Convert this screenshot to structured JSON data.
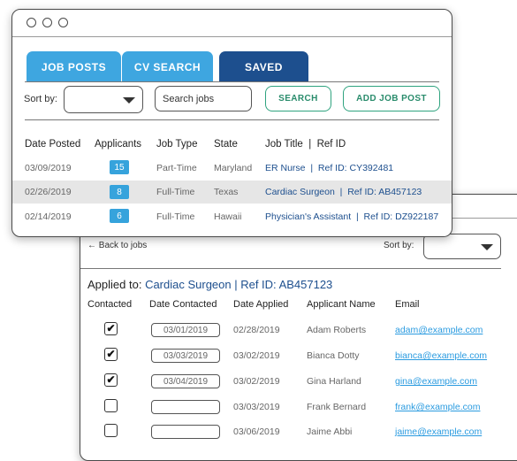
{
  "jobs_window": {
    "tabs": [
      {
        "label": "JOB POSTS"
      },
      {
        "label": "CV SEARCH"
      },
      {
        "label": "SAVED"
      }
    ],
    "sort_label": "Sort by:",
    "search_text": "Search jobs",
    "search_button": "SEARCH",
    "add_button": "ADD JOB POST",
    "columns": [
      "Date Posted",
      "Applicants",
      "Job Type",
      "State",
      "Job Title  |  Ref ID"
    ],
    "rows": [
      {
        "date": "03/09/2019",
        "applicants": "15",
        "type": "Part-Time",
        "state": "Maryland",
        "title": "ER Nurse  |  Ref ID: CY392481"
      },
      {
        "date": "02/26/2019",
        "applicants": "8",
        "type": "Full-Time",
        "state": "Texas",
        "title": "Cardiac Surgeon  |  Ref ID: AB457123"
      },
      {
        "date": "02/14/2019",
        "applicants": "6",
        "type": "Full-Time",
        "state": "Hawaii",
        "title": "Physician's Assistant  |  Ref ID: DZ922187"
      }
    ]
  },
  "applicants_window": {
    "back_link": "← Back to jobs",
    "sort_label": "Sort by:",
    "applied_prefix": "Applied to:",
    "applied_job": "Cardiac Surgeon  |  Ref ID: AB457123",
    "columns": [
      "Contacted",
      "Date Contacted",
      "Date Applied",
      "Applicant Name",
      "Email"
    ],
    "rows": [
      {
        "contacted": "✔",
        "date_contacted": "03/01/2019",
        "date_applied": "02/28/2019",
        "name": "Adam Roberts",
        "email": "adam@example.com"
      },
      {
        "contacted": "✔",
        "date_contacted": "03/03/2019",
        "date_applied": "03/02/2019",
        "name": "Bianca Dotty",
        "email": "bianca@example.com"
      },
      {
        "contacted": "✔",
        "date_contacted": "03/04/2019",
        "date_applied": "03/02/2019",
        "name": "Gina Harland",
        "email": "gina@example.com"
      },
      {
        "contacted": "",
        "date_contacted": "",
        "date_applied": "03/03/2019",
        "name": "Frank Bernard",
        "email": "frank@example.com"
      },
      {
        "contacted": "",
        "date_contacted": "",
        "date_applied": "03/06/2019",
        "name": "Jaime Abbi",
        "email": "jaime@example.com"
      }
    ]
  },
  "colors": {
    "tab_light": "#3ea6e0",
    "tab_dark": "#1d4f8e",
    "accent_green": "#2fa37f",
    "badge": "#36a3dc",
    "link": "#2a9be0"
  }
}
